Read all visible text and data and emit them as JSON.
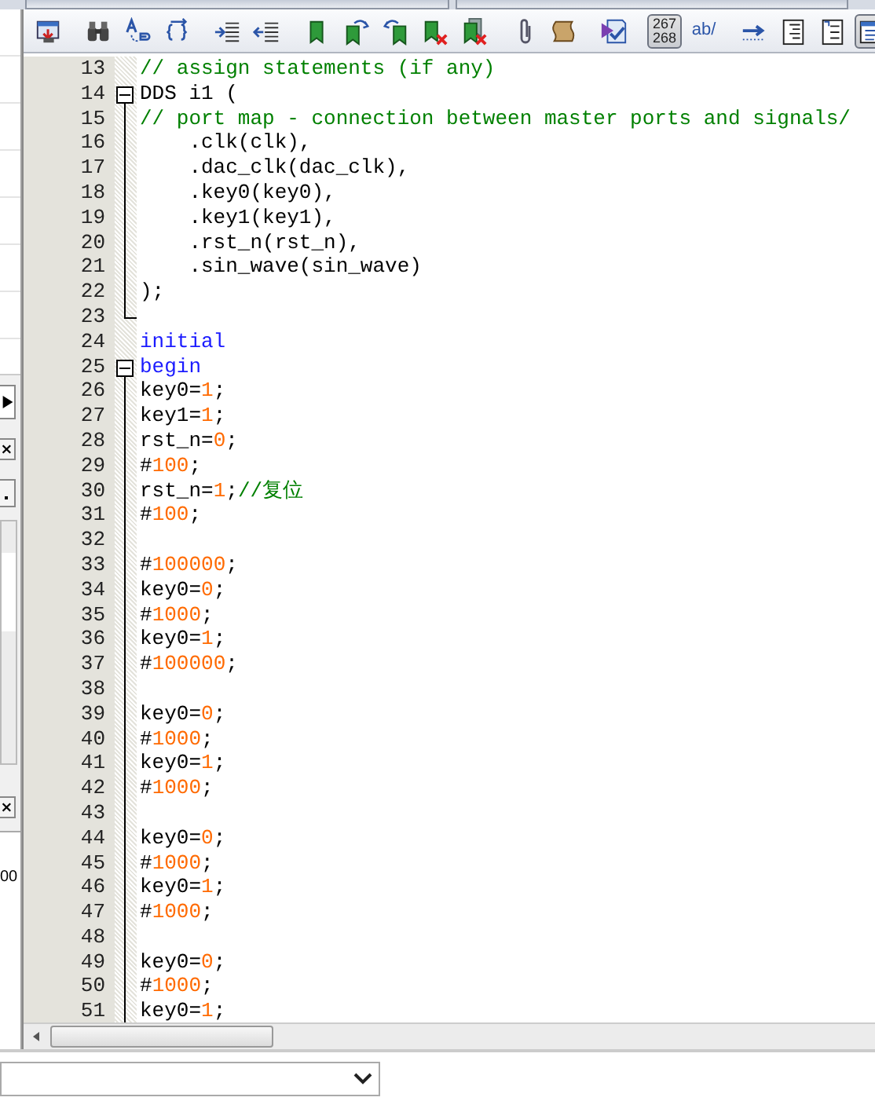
{
  "toolbar": [
    {
      "kind": "compile",
      "pressed": false
    },
    {
      "kind": "separator"
    },
    {
      "kind": "binoculars",
      "pressed": false
    },
    {
      "kind": "replace",
      "pressed": false
    },
    {
      "kind": "brackets",
      "pressed": false
    },
    {
      "kind": "separator"
    },
    {
      "kind": "indent",
      "pressed": false
    },
    {
      "kind": "outdent",
      "pressed": false
    },
    {
      "kind": "separator"
    },
    {
      "kind": "bookmark",
      "pressed": false
    },
    {
      "kind": "bookmark-next",
      "pressed": false
    },
    {
      "kind": "bookmark-prev",
      "pressed": false
    },
    {
      "kind": "bookmark-delete",
      "pressed": false
    },
    {
      "kind": "bookmark-clear",
      "pressed": false
    },
    {
      "kind": "separator"
    },
    {
      "kind": "paperclip",
      "pressed": false
    },
    {
      "kind": "scroll",
      "pressed": false
    },
    {
      "kind": "separator"
    },
    {
      "kind": "checklist",
      "pressed": false
    },
    {
      "kind": "separator"
    },
    {
      "kind": "text",
      "label": "267\n268",
      "pressed": true
    },
    {
      "kind": "text",
      "label": "ab/",
      "pressed": false
    },
    {
      "kind": "separator"
    },
    {
      "kind": "arrow",
      "pressed": false
    },
    {
      "kind": "lines",
      "pressed": false
    },
    {
      "kind": "numbered-lines",
      "pressed": false
    },
    {
      "kind": "panel",
      "pressed": true
    }
  ],
  "editor": {
    "lines": [
      {
        "number": "13",
        "segments": [
          {
            "kind": "comment",
            "text": "// assign statements (if any)"
          }
        ]
      },
      {
        "number": "14",
        "expanded": true,
        "segments": [
          {
            "kind": "plain",
            "text": "DDS i1 ("
          }
        ],
        "children": [
          {
            "number": "15",
            "segments": [
              {
                "kind": "comment",
                "text": "// port map - connection between master ports and signals/"
              }
            ]
          },
          {
            "number": "16",
            "segments": [
              {
                "kind": "plain",
                "text": "    .clk(clk),"
              }
            ]
          },
          {
            "number": "17",
            "segments": [
              {
                "kind": "plain",
                "text": "    .dac_clk(dac_clk),"
              }
            ]
          },
          {
            "number": "18",
            "segments": [
              {
                "kind": "plain",
                "text": "    .key0(key0),"
              }
            ]
          },
          {
            "number": "19",
            "segments": [
              {
                "kind": "plain",
                "text": "    .key1(key1),"
              }
            ]
          },
          {
            "number": "20",
            "segments": [
              {
                "kind": "plain",
                "text": "    .rst_n(rst_n),"
              }
            ]
          },
          {
            "number": "21",
            "segments": [
              {
                "kind": "plain",
                "text": "    .sin_wave(sin_wave)"
              }
            ]
          },
          {
            "number": "22",
            "segments": [
              {
                "kind": "plain",
                "text": ");"
              }
            ]
          },
          {
            "number": "23"
          }
        ]
      },
      {
        "number": "24",
        "segments": [
          {
            "kind": "keyword",
            "text": "initial"
          }
        ]
      },
      {
        "number": "25",
        "expanded": true,
        "segments": [
          {
            "kind": "keyword",
            "text": "begin"
          }
        ],
        "children": [
          {
            "number": "26",
            "segments": [
              {
                "kind": "plain",
                "text": "key0="
              },
              {
                "kind": "number",
                "text": "1"
              },
              {
                "kind": "plain",
                "text": ";"
              }
            ]
          },
          {
            "number": "27",
            "segments": [
              {
                "kind": "plain",
                "text": "key1="
              },
              {
                "kind": "number",
                "text": "1"
              },
              {
                "kind": "plain",
                "text": ";"
              }
            ]
          },
          {
            "number": "28",
            "segments": [
              {
                "kind": "plain",
                "text": "rst_n="
              },
              {
                "kind": "number",
                "text": "0"
              },
              {
                "kind": "plain",
                "text": ";"
              }
            ]
          },
          {
            "number": "29",
            "segments": [
              {
                "kind": "plain",
                "text": "#"
              },
              {
                "kind": "number",
                "text": "100"
              },
              {
                "kind": "plain",
                "text": ";"
              }
            ]
          },
          {
            "number": "30",
            "segments": [
              {
                "kind": "plain",
                "text": "rst_n="
              },
              {
                "kind": "number",
                "text": "1"
              },
              {
                "kind": "plain",
                "text": ";"
              },
              {
                "kind": "comment",
                "text": "//复位"
              }
            ]
          },
          {
            "number": "31",
            "segments": [
              {
                "kind": "plain",
                "text": "#"
              },
              {
                "kind": "number",
                "text": "100"
              },
              {
                "kind": "plain",
                "text": ";"
              }
            ]
          },
          {
            "number": "32"
          },
          {
            "number": "33",
            "segments": [
              {
                "kind": "plain",
                "text": "#"
              },
              {
                "kind": "number",
                "text": "100000"
              },
              {
                "kind": "plain",
                "text": ";"
              }
            ]
          },
          {
            "number": "34",
            "segments": [
              {
                "kind": "plain",
                "text": "key0="
              },
              {
                "kind": "number",
                "text": "0"
              },
              {
                "kind": "plain",
                "text": ";"
              }
            ]
          },
          {
            "number": "35",
            "segments": [
              {
                "kind": "plain",
                "text": "#"
              },
              {
                "kind": "number",
                "text": "1000"
              },
              {
                "kind": "plain",
                "text": ";"
              }
            ]
          },
          {
            "number": "36",
            "segments": [
              {
                "kind": "plain",
                "text": "key0="
              },
              {
                "kind": "number",
                "text": "1"
              },
              {
                "kind": "plain",
                "text": ";"
              }
            ]
          },
          {
            "number": "37",
            "segments": [
              {
                "kind": "plain",
                "text": "#"
              },
              {
                "kind": "number",
                "text": "100000"
              },
              {
                "kind": "plain",
                "text": ";"
              }
            ]
          },
          {
            "number": "38"
          },
          {
            "number": "39",
            "segments": [
              {
                "kind": "plain",
                "text": "key0="
              },
              {
                "kind": "number",
                "text": "0"
              },
              {
                "kind": "plain",
                "text": ";"
              }
            ]
          },
          {
            "number": "40",
            "segments": [
              {
                "kind": "plain",
                "text": "#"
              },
              {
                "kind": "number",
                "text": "1000"
              },
              {
                "kind": "plain",
                "text": ";"
              }
            ]
          },
          {
            "number": "41",
            "segments": [
              {
                "kind": "plain",
                "text": "key0="
              },
              {
                "kind": "number",
                "text": "1"
              },
              {
                "kind": "plain",
                "text": ";"
              }
            ]
          },
          {
            "number": "42",
            "segments": [
              {
                "kind": "plain",
                "text": "#"
              },
              {
                "kind": "number",
                "text": "1000"
              },
              {
                "kind": "plain",
                "text": ";"
              }
            ]
          },
          {
            "number": "43"
          },
          {
            "number": "44",
            "segments": [
              {
                "kind": "plain",
                "text": "key0="
              },
              {
                "kind": "number",
                "text": "0"
              },
              {
                "kind": "plain",
                "text": ";"
              }
            ]
          },
          {
            "number": "45",
            "segments": [
              {
                "kind": "plain",
                "text": "#"
              },
              {
                "kind": "number",
                "text": "1000"
              },
              {
                "kind": "plain",
                "text": ";"
              }
            ]
          },
          {
            "number": "46",
            "segments": [
              {
                "kind": "plain",
                "text": "key0="
              },
              {
                "kind": "number",
                "text": "1"
              },
              {
                "kind": "plain",
                "text": ";"
              }
            ]
          },
          {
            "number": "47",
            "segments": [
              {
                "kind": "plain",
                "text": "#"
              },
              {
                "kind": "number",
                "text": "1000"
              },
              {
                "kind": "plain",
                "text": ";"
              }
            ]
          },
          {
            "number": "48"
          },
          {
            "number": "49",
            "segments": [
              {
                "kind": "plain",
                "text": "key0="
              },
              {
                "kind": "number",
                "text": "0"
              },
              {
                "kind": "plain",
                "text": ";"
              }
            ]
          },
          {
            "number": "50",
            "segments": [
              {
                "kind": "plain",
                "text": "#"
              },
              {
                "kind": "number",
                "text": "1000"
              },
              {
                "kind": "plain",
                "text": ";"
              }
            ]
          },
          {
            "number": "51",
            "segments": [
              {
                "kind": "plain",
                "text": "key0="
              },
              {
                "kind": "number",
                "text": "1"
              },
              {
                "kind": "plain",
                "text": ";"
              }
            ]
          }
        ]
      }
    ]
  },
  "left_panel": {
    "cell_text": "00"
  }
}
